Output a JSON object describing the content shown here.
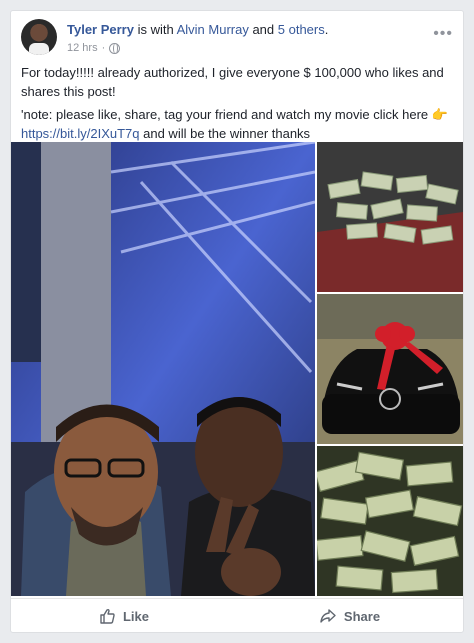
{
  "post": {
    "author": "Tyler Perry",
    "with_text": " is with ",
    "tagged": "Alvin Murray",
    "and_text": " and ",
    "others": "5 others",
    "end_text": ".",
    "time": "12 hrs",
    "dot": " · ",
    "menu": "•••",
    "body_line1": "For today!!!!! already authorized, I give everyone $ 100,000 who likes and shares this post!",
    "body_line2a": "'note: please like, share, tag your friend and watch my movie click here ",
    "pointing_emoji": "👉",
    "link": "https://bit.ly/2IXuT7q",
    "body_line2b": " and will be the winner thanks"
  },
  "photos": {
    "main": "photo-two-men-selfie",
    "side": [
      "photo-cash-stacks-suitcase",
      "photo-black-car-red-bow",
      "photo-cash-stacks-pile"
    ]
  },
  "actions": {
    "like_label": "Like",
    "share_label": "Share"
  },
  "icons": {
    "like": "thumbs-up-icon",
    "share": "share-arrow-icon",
    "globe": "globe-icon"
  },
  "colors": {
    "link": "#365899",
    "meta": "#90949c",
    "background": "#e9ebee"
  }
}
